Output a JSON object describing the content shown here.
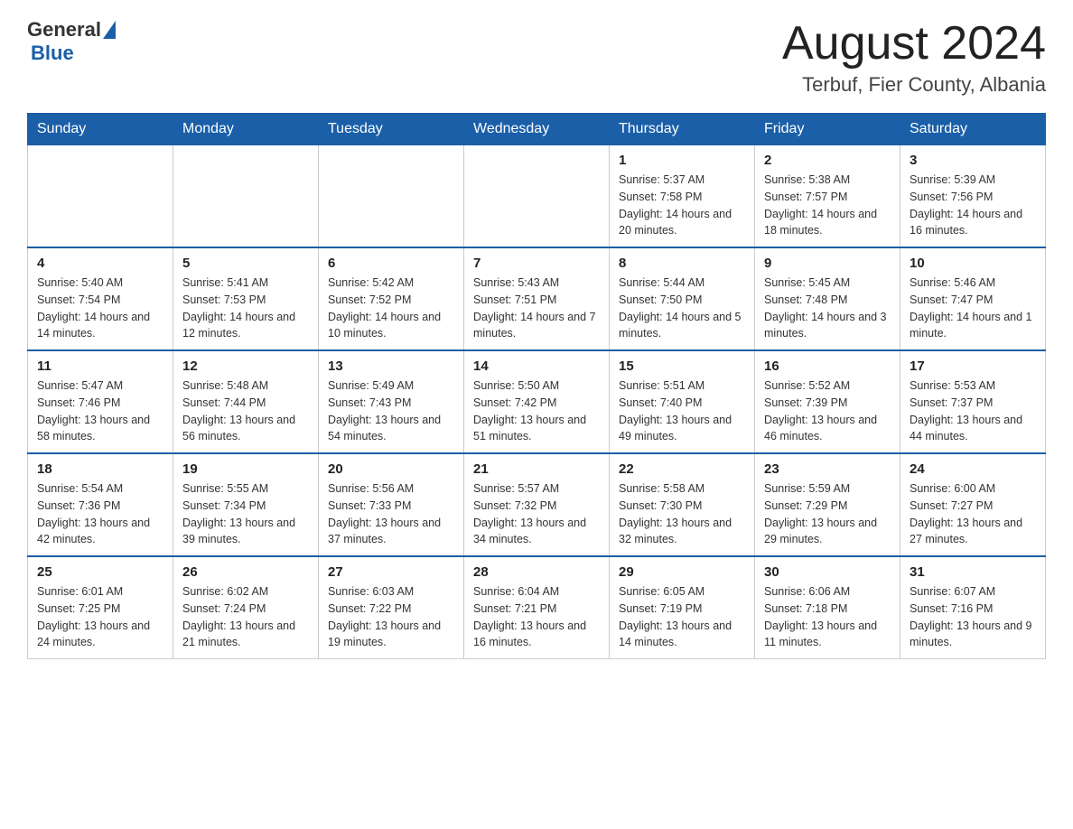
{
  "header": {
    "logo_general": "General",
    "logo_blue": "Blue",
    "month_title": "August 2024",
    "location": "Terbuf, Fier County, Albania"
  },
  "days_of_week": [
    "Sunday",
    "Monday",
    "Tuesday",
    "Wednesday",
    "Thursday",
    "Friday",
    "Saturday"
  ],
  "weeks": [
    [
      {
        "day": "",
        "info": ""
      },
      {
        "day": "",
        "info": ""
      },
      {
        "day": "",
        "info": ""
      },
      {
        "day": "",
        "info": ""
      },
      {
        "day": "1",
        "info": "Sunrise: 5:37 AM\nSunset: 7:58 PM\nDaylight: 14 hours and 20 minutes."
      },
      {
        "day": "2",
        "info": "Sunrise: 5:38 AM\nSunset: 7:57 PM\nDaylight: 14 hours and 18 minutes."
      },
      {
        "day": "3",
        "info": "Sunrise: 5:39 AM\nSunset: 7:56 PM\nDaylight: 14 hours and 16 minutes."
      }
    ],
    [
      {
        "day": "4",
        "info": "Sunrise: 5:40 AM\nSunset: 7:54 PM\nDaylight: 14 hours and 14 minutes."
      },
      {
        "day": "5",
        "info": "Sunrise: 5:41 AM\nSunset: 7:53 PM\nDaylight: 14 hours and 12 minutes."
      },
      {
        "day": "6",
        "info": "Sunrise: 5:42 AM\nSunset: 7:52 PM\nDaylight: 14 hours and 10 minutes."
      },
      {
        "day": "7",
        "info": "Sunrise: 5:43 AM\nSunset: 7:51 PM\nDaylight: 14 hours and 7 minutes."
      },
      {
        "day": "8",
        "info": "Sunrise: 5:44 AM\nSunset: 7:50 PM\nDaylight: 14 hours and 5 minutes."
      },
      {
        "day": "9",
        "info": "Sunrise: 5:45 AM\nSunset: 7:48 PM\nDaylight: 14 hours and 3 minutes."
      },
      {
        "day": "10",
        "info": "Sunrise: 5:46 AM\nSunset: 7:47 PM\nDaylight: 14 hours and 1 minute."
      }
    ],
    [
      {
        "day": "11",
        "info": "Sunrise: 5:47 AM\nSunset: 7:46 PM\nDaylight: 13 hours and 58 minutes."
      },
      {
        "day": "12",
        "info": "Sunrise: 5:48 AM\nSunset: 7:44 PM\nDaylight: 13 hours and 56 minutes."
      },
      {
        "day": "13",
        "info": "Sunrise: 5:49 AM\nSunset: 7:43 PM\nDaylight: 13 hours and 54 minutes."
      },
      {
        "day": "14",
        "info": "Sunrise: 5:50 AM\nSunset: 7:42 PM\nDaylight: 13 hours and 51 minutes."
      },
      {
        "day": "15",
        "info": "Sunrise: 5:51 AM\nSunset: 7:40 PM\nDaylight: 13 hours and 49 minutes."
      },
      {
        "day": "16",
        "info": "Sunrise: 5:52 AM\nSunset: 7:39 PM\nDaylight: 13 hours and 46 minutes."
      },
      {
        "day": "17",
        "info": "Sunrise: 5:53 AM\nSunset: 7:37 PM\nDaylight: 13 hours and 44 minutes."
      }
    ],
    [
      {
        "day": "18",
        "info": "Sunrise: 5:54 AM\nSunset: 7:36 PM\nDaylight: 13 hours and 42 minutes."
      },
      {
        "day": "19",
        "info": "Sunrise: 5:55 AM\nSunset: 7:34 PM\nDaylight: 13 hours and 39 minutes."
      },
      {
        "day": "20",
        "info": "Sunrise: 5:56 AM\nSunset: 7:33 PM\nDaylight: 13 hours and 37 minutes."
      },
      {
        "day": "21",
        "info": "Sunrise: 5:57 AM\nSunset: 7:32 PM\nDaylight: 13 hours and 34 minutes."
      },
      {
        "day": "22",
        "info": "Sunrise: 5:58 AM\nSunset: 7:30 PM\nDaylight: 13 hours and 32 minutes."
      },
      {
        "day": "23",
        "info": "Sunrise: 5:59 AM\nSunset: 7:29 PM\nDaylight: 13 hours and 29 minutes."
      },
      {
        "day": "24",
        "info": "Sunrise: 6:00 AM\nSunset: 7:27 PM\nDaylight: 13 hours and 27 minutes."
      }
    ],
    [
      {
        "day": "25",
        "info": "Sunrise: 6:01 AM\nSunset: 7:25 PM\nDaylight: 13 hours and 24 minutes."
      },
      {
        "day": "26",
        "info": "Sunrise: 6:02 AM\nSunset: 7:24 PM\nDaylight: 13 hours and 21 minutes."
      },
      {
        "day": "27",
        "info": "Sunrise: 6:03 AM\nSunset: 7:22 PM\nDaylight: 13 hours and 19 minutes."
      },
      {
        "day": "28",
        "info": "Sunrise: 6:04 AM\nSunset: 7:21 PM\nDaylight: 13 hours and 16 minutes."
      },
      {
        "day": "29",
        "info": "Sunrise: 6:05 AM\nSunset: 7:19 PM\nDaylight: 13 hours and 14 minutes."
      },
      {
        "day": "30",
        "info": "Sunrise: 6:06 AM\nSunset: 7:18 PM\nDaylight: 13 hours and 11 minutes."
      },
      {
        "day": "31",
        "info": "Sunrise: 6:07 AM\nSunset: 7:16 PM\nDaylight: 13 hours and 9 minutes."
      }
    ]
  ]
}
